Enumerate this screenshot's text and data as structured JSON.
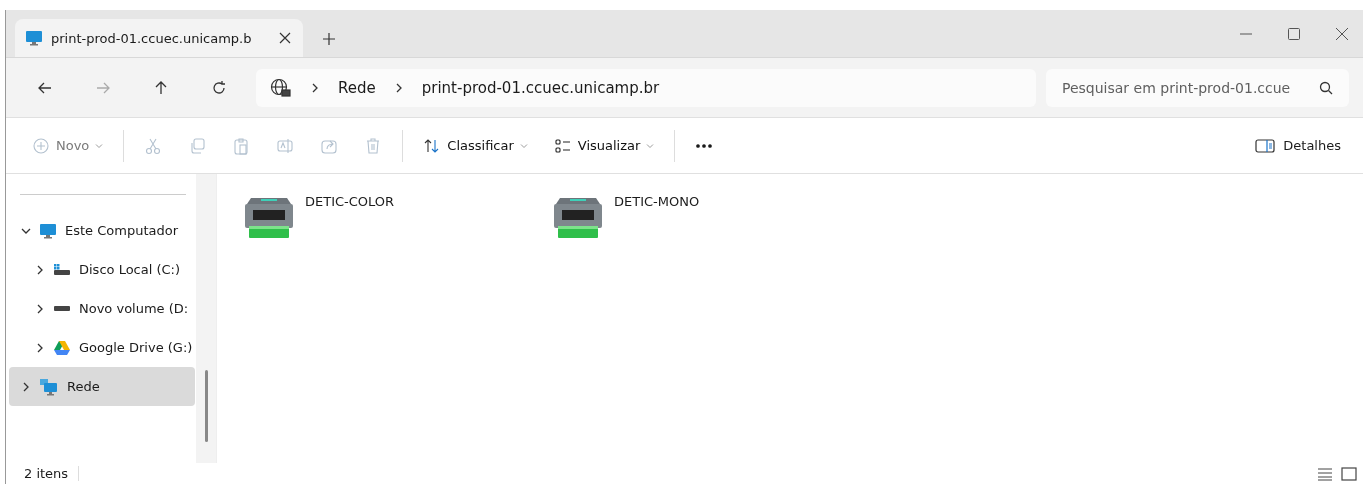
{
  "tab": {
    "title": "print-prod-01.ccuec.unicamp.b",
    "selected": true
  },
  "nav": [
    {
      "kind": "back",
      "disabled": false
    },
    {
      "kind": "forward",
      "disabled": true
    },
    {
      "kind": "up",
      "disabled": false
    },
    {
      "kind": "refresh",
      "disabled": false
    }
  ],
  "breadcrumb": [
    "Rede",
    "print-prod-01.ccuec.unicamp.br"
  ],
  "search": {
    "placeholder": "Pesquisar em print-prod-01.ccue"
  },
  "toolbar": [
    {
      "kind": "new",
      "label": "Novo",
      "disabled": true
    },
    {
      "kind": "cut",
      "disabled": true
    },
    {
      "kind": "copy",
      "disabled": true
    },
    {
      "kind": "paste",
      "disabled": true
    },
    {
      "kind": "rename",
      "disabled": true
    },
    {
      "kind": "share",
      "disabled": true
    },
    {
      "kind": "delete",
      "disabled": true
    },
    {
      "kind": "sort",
      "label": "Classificar",
      "disabled": false
    },
    {
      "kind": "view",
      "label": "Visualizar",
      "disabled": false
    },
    {
      "kind": "more",
      "disabled": false
    }
  ],
  "details_button": "Detalhes",
  "sidebar": {
    "items": [
      {
        "kind": "pc",
        "label": "Este Computador",
        "expanded": true,
        "selected": false,
        "children": [
          {
            "kind": "disk",
            "label": "Disco Local (C:)",
            "expanded": false,
            "selected": false
          },
          {
            "kind": "drive",
            "label": "Novo volume (D:",
            "expanded": false,
            "selected": false
          },
          {
            "kind": "gdrive",
            "label": "Google Drive (G:)",
            "expanded": false,
            "selected": false
          }
        ]
      },
      {
        "kind": "network",
        "label": "Rede",
        "expanded": false,
        "selected": true
      }
    ]
  },
  "items": [
    {
      "name": "DETIC-COLOR"
    },
    {
      "name": "DETIC-MONO"
    }
  ],
  "status_bar": {
    "count": "2 itens"
  }
}
